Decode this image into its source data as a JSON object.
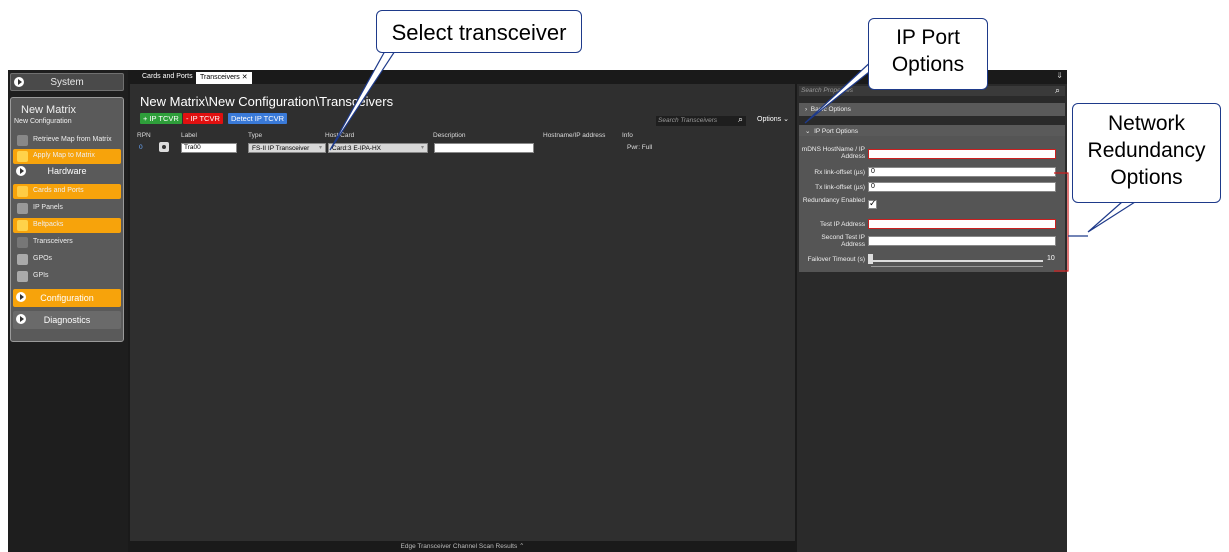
{
  "callouts": {
    "select_transceiver": "Select transceiver",
    "ip_port_options": [
      "IP Port",
      "Options"
    ],
    "network_redundancy": [
      "Network",
      "Redundancy",
      "Options"
    ]
  },
  "sidebar": {
    "system": "System",
    "matrix_title": "New Matrix",
    "matrix_sub": "New Configuration",
    "items": [
      {
        "label": "Retrieve Map from Matrix",
        "icon": "retrieve-icon"
      },
      {
        "label": "Apply Map to Matrix",
        "icon": "apply-icon"
      }
    ],
    "hardware": "Hardware",
    "hw_items": [
      {
        "label": "Cards and Ports",
        "icon": "cards-icon"
      },
      {
        "label": "IP Panels",
        "icon": "panel-icon"
      },
      {
        "label": "Beltpacks",
        "icon": "beltpack-icon"
      },
      {
        "label": "Transceivers",
        "icon": "transceiver-icon"
      },
      {
        "label": "GPOs",
        "icon": "gpo-icon"
      },
      {
        "label": "GPIs",
        "icon": "gpi-icon"
      }
    ],
    "configuration": "Configuration",
    "diagnostics": "Diagnostics"
  },
  "tabs": [
    {
      "label": "Cards and Ports"
    },
    {
      "label": "Transceivers ✕"
    }
  ],
  "main": {
    "title": "New Matrix\\New Configuration\\Transceivers",
    "btn_add": "+ IP TCVR",
    "btn_remove": "- IP TCVR",
    "btn_detect": "Detect IP TCVR",
    "search_placeholder": "Search Transceivers",
    "options": "Options",
    "columns": [
      "RPN",
      "Label",
      "Type",
      "Host Card",
      "Description",
      "Hostname/IP address",
      "Info"
    ],
    "row": {
      "rpn": "0",
      "label": "Tra00",
      "type": "FS-II IP Transceiver",
      "host_card": "Card:3 E-IPA-HX",
      "description": "",
      "hostname": "",
      "info": "Pwr: Full"
    },
    "status": "Edge Transceiver Channel Scan Results"
  },
  "properties": {
    "search_placeholder": "Search Properties",
    "basic_options": "Basic Options",
    "ip_port_options": "IP Port Options",
    "fields": {
      "mdns": {
        "label": "mDNS HostName / IP Address",
        "value": ""
      },
      "rx": {
        "label": "Rx link-offset (µs)",
        "value": "0"
      },
      "tx": {
        "label": "Tx link-offset (µs)",
        "value": "0"
      },
      "redundancy": {
        "label": "Redundancy Enabled",
        "checked": true
      },
      "test_ip": {
        "label": "Test IP Address",
        "value": ""
      },
      "second_test_ip": {
        "label": "Second Test IP Address",
        "value": ""
      },
      "failover": {
        "label": "Failover Timeout (s)",
        "value": "10"
      }
    }
  },
  "colors": {
    "orange": "#f7a30b",
    "green": "#2e9e3a",
    "red": "#e01010",
    "blue": "#3a7ad8",
    "callout_border": "#1e3a8a"
  }
}
